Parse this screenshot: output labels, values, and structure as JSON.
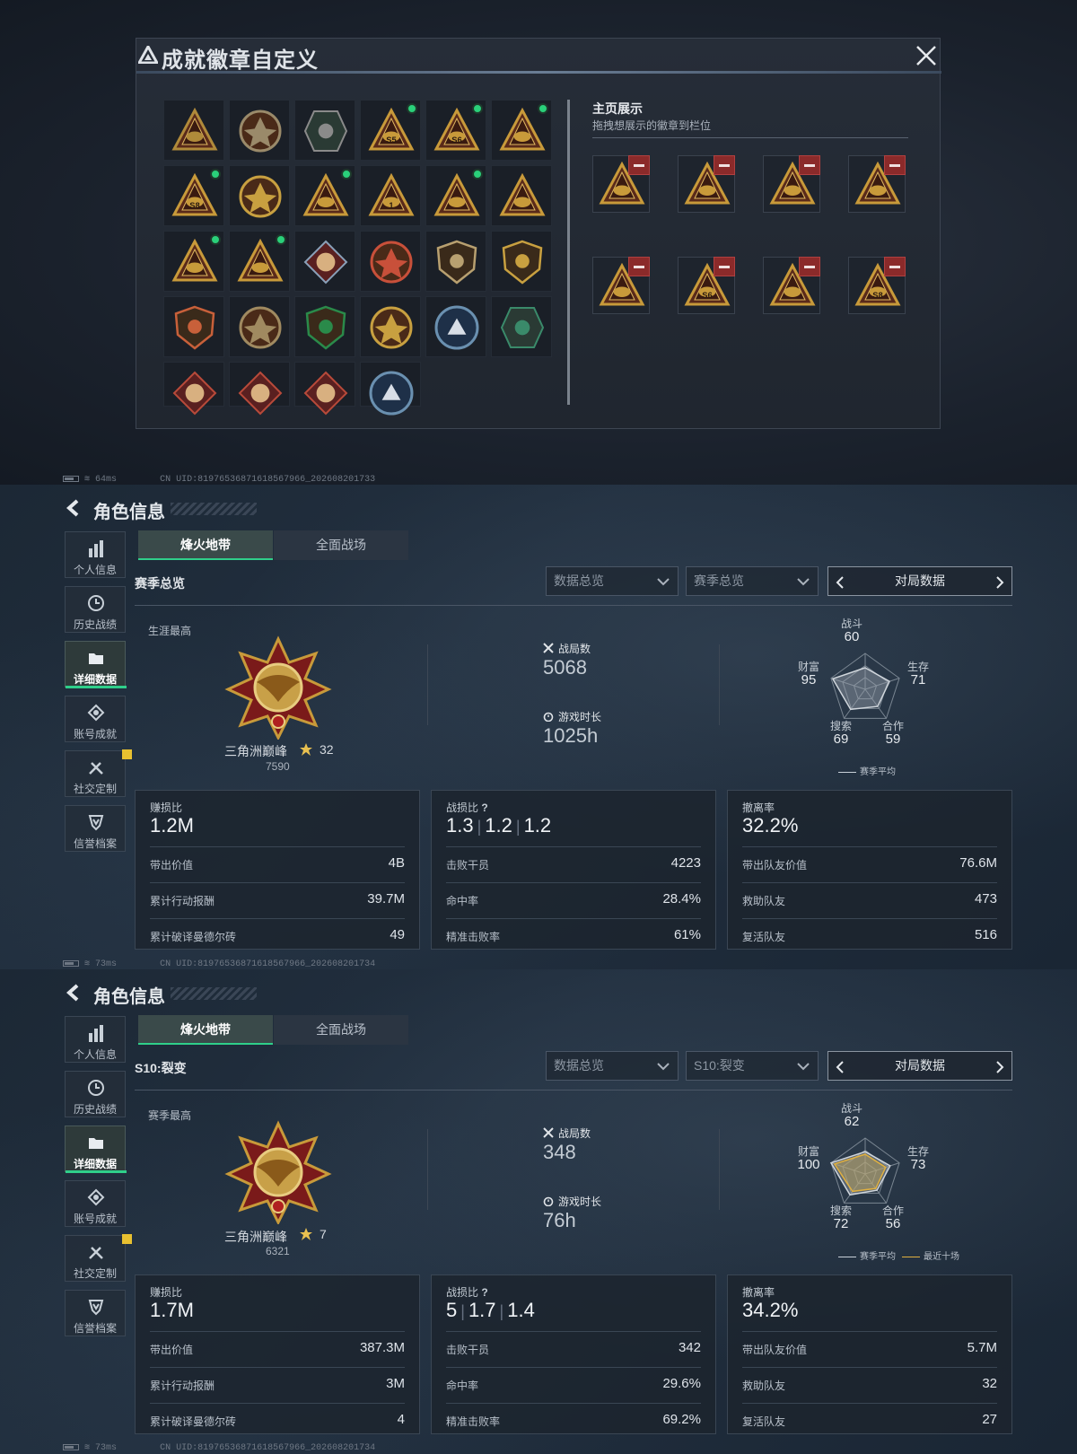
{
  "badge_modal": {
    "title": "成就徽章自定义",
    "showcase_title": "主页展示",
    "showcase_subtitle": "拖拽想展示的徽章到栏位",
    "grid": [
      {
        "icon": "delta-triangle-badge",
        "label": "",
        "dot": false,
        "color": "#b08a3a"
      },
      {
        "icon": "helicopter-badge",
        "label": "",
        "dot": false,
        "color": "#9a8a6a"
      },
      {
        "icon": "hex-shield-badge",
        "label": "",
        "dot": false,
        "color": "#8a8a8a"
      },
      {
        "icon": "helmet-triangle-badge",
        "label": "S5",
        "dot": true,
        "color": "#c89a3a"
      },
      {
        "icon": "helmet-triangle-badge",
        "label": "S6",
        "dot": true,
        "color": "#c89a3a"
      },
      {
        "icon": "hourglass-triangle-badge",
        "label": "",
        "dot": true,
        "color": "#c89a3a"
      },
      {
        "icon": "s8-triangle-badge",
        "label": "S8",
        "dot": true,
        "color": "#c89a3a"
      },
      {
        "icon": "eagle-crest-badge",
        "label": "",
        "dot": false,
        "color": "#c8a040"
      },
      {
        "icon": "helmet-triangle-badge",
        "label": "",
        "dot": true,
        "color": "#c89a3a"
      },
      {
        "icon": "number-one-triangle-badge",
        "label": "1",
        "dot": false,
        "color": "#c89a3a"
      },
      {
        "icon": "soldier-triangle-badge",
        "label": "",
        "dot": true,
        "color": "#c89a3a"
      },
      {
        "icon": "crest-triangle-badge",
        "label": "",
        "dot": false,
        "color": "#c89a3a"
      },
      {
        "icon": "squad-triangle-badge",
        "label": "",
        "dot": true,
        "color": "#c89a3a"
      },
      {
        "icon": "rocket-triangle-badge",
        "label": "",
        "dot": true,
        "color": "#c89a3a"
      },
      {
        "icon": "flower-diamond-badge",
        "label": "",
        "dot": false,
        "color": "#8aa0b8"
      },
      {
        "icon": "cross-medal-badge",
        "label": "",
        "dot": false,
        "color": "#c8503a"
      },
      {
        "icon": "shield-wings-badge",
        "label": "",
        "dot": false,
        "color": "#b8a070"
      },
      {
        "icon": "starred-shield-badge",
        "label": "",
        "dot": false,
        "color": "#c8a040"
      },
      {
        "icon": "starred-shield-badge",
        "label": "",
        "dot": false,
        "color": "#c8603a"
      },
      {
        "icon": "target-skull-badge",
        "label": "",
        "dot": false,
        "color": "#a08a60"
      },
      {
        "icon": "rifle-shield-badge",
        "label": "",
        "dot": false,
        "color": "#2a8a4a"
      },
      {
        "icon": "laurel-crest-badge",
        "label": "",
        "dot": false,
        "color": "#c8a040"
      },
      {
        "icon": "wolf-round-badge",
        "label": "",
        "dot": false,
        "color": "#6a90b0"
      },
      {
        "icon": "wing-hex-badge",
        "label": "",
        "dot": false,
        "color": "#3a8a6a"
      },
      {
        "icon": "dragon-diamond-badge",
        "label": "",
        "dot": false,
        "color": "#b84a3a"
      },
      {
        "icon": "dragon-diamond-badge",
        "label": "",
        "dot": false,
        "color": "#b84a3a"
      },
      {
        "icon": "runner-diamond-badge",
        "label": "",
        "dot": false,
        "color": "#b84a3a"
      },
      {
        "icon": "wolf-round-badge",
        "label": "",
        "dot": false,
        "color": "#6a90b0"
      }
    ],
    "showcase": [
      {
        "icon": "helmet-triangle-badge",
        "label": ""
      },
      {
        "icon": "rocket-triangle-badge",
        "label": ""
      },
      {
        "icon": "squad-triangle-badge",
        "label": ""
      },
      {
        "icon": "soldier-triangle-badge",
        "label": ""
      },
      {
        "icon": "hourglass-triangle-badge",
        "label": ""
      },
      {
        "icon": "helmet-triangle-badge",
        "label": "S6"
      },
      {
        "icon": "hourglass-triangle-badge",
        "label": ""
      },
      {
        "icon": "s8-triangle-badge",
        "label": "S8"
      }
    ]
  },
  "status_lines": [
    {
      "ping": "64ms",
      "uid": "CN UID:8197653687161856​7966_202608201733"
    },
    {
      "ping": "73ms",
      "uid": "CN UID:8197653687161856​7966_202608201734"
    },
    {
      "ping": "73ms",
      "uid": "CN UID:8197653687161856​7966_202608201734"
    }
  ],
  "sidebar": [
    {
      "label": "个人信息",
      "icon": "bar-chart-icon"
    },
    {
      "label": "历史战绩",
      "icon": "clock-icon"
    },
    {
      "label": "详细数据",
      "icon": "folder-icon"
    },
    {
      "label": "账号成就",
      "icon": "medal-icon"
    },
    {
      "label": "社交定制",
      "icon": "tools-icon"
    },
    {
      "label": "信誉档案",
      "icon": "shield-icon"
    }
  ],
  "panels": [
    {
      "title": "角色信息",
      "tab1": "烽火地带",
      "tab2": "全面战场",
      "section": "赛季总览",
      "dropdown1": "数据总览",
      "dropdown2": "赛季总览",
      "nav_label": "对局数据",
      "best_label": "生涯最高",
      "rank_name": "三角洲巅峰",
      "rank_stars": "32",
      "rank_score": "7590",
      "matches_label": "战局数",
      "matches": "5068",
      "time_label": "游戏时长",
      "time": "1025h",
      "radar": {
        "combat_label": "战斗",
        "combat": "60",
        "survive_label": "生存",
        "survive": "71",
        "coop_label": "合作",
        "coop": "59",
        "search_label": "搜索",
        "search": "69",
        "wealth_label": "财富",
        "wealth": "95"
      },
      "radar_values": {
        "season_avg": [
          60,
          71,
          59,
          69,
          95
        ],
        "recent": null
      },
      "legend1": "赛季平均",
      "legend2": "",
      "card1": {
        "label": "赚损比",
        "big": "1.2M",
        "rows": [
          [
            "带出价值",
            "4B"
          ],
          [
            "累计行动报酬",
            "39.7M"
          ],
          [
            "累计破译曼德尔砖",
            "49"
          ]
        ]
      },
      "card2": {
        "label": "战损比",
        "kd": [
          "1.3",
          "1.2",
          "1.2"
        ],
        "rows": [
          [
            "击败干员",
            "4223"
          ],
          [
            "命中率",
            "28.4%"
          ],
          [
            "精准击败率",
            "61%"
          ]
        ]
      },
      "card3": {
        "label": "撤离率",
        "big": "32.2%",
        "rows": [
          [
            "带出队友价值",
            "76.6M"
          ],
          [
            "救助队友",
            "473"
          ],
          [
            "复活队友",
            "516"
          ]
        ]
      }
    },
    {
      "title": "角色信息",
      "tab1": "烽火地带",
      "tab2": "全面战场",
      "section": "S10:裂变",
      "dropdown1": "数据总览",
      "dropdown2": "S10:裂变",
      "nav_label": "对局数据",
      "best_label": "赛季最高",
      "rank_name": "三角洲巅峰",
      "rank_stars": "7",
      "rank_score": "6321",
      "matches_label": "战局数",
      "matches": "348",
      "time_label": "游戏时长",
      "time": "76h",
      "radar": {
        "combat_label": "战斗",
        "combat": "62",
        "survive_label": "生存",
        "survive": "73",
        "coop_label": "合作",
        "coop": "56",
        "search_label": "搜索",
        "search": "72",
        "wealth_label": "财富",
        "wealth": "100"
      },
      "radar_values": {
        "season_avg": [
          62,
          73,
          56,
          72,
          100
        ],
        "recent": [
          55,
          60,
          50,
          60,
          90
        ]
      },
      "legend1": "赛季平均",
      "legend2": "最近十场",
      "card1": {
        "label": "赚损比",
        "big": "1.7M",
        "rows": [
          [
            "带出价值",
            "387.3M"
          ],
          [
            "累计行动报酬",
            "3M"
          ],
          [
            "累计破译曼德尔砖",
            "4"
          ]
        ]
      },
      "card2": {
        "label": "战损比",
        "kd": [
          "5",
          "1.7",
          "1.4"
        ],
        "rows": [
          [
            "击败干员",
            "342"
          ],
          [
            "命中率",
            "29.6%"
          ],
          [
            "精准击败率",
            "69.2%"
          ]
        ]
      },
      "card3": {
        "label": "撤离率",
        "big": "34.2%",
        "rows": [
          [
            "带出队友价值",
            "5.7M"
          ],
          [
            "救助队友",
            "32"
          ],
          [
            "复活队友",
            "27"
          ]
        ]
      }
    }
  ]
}
